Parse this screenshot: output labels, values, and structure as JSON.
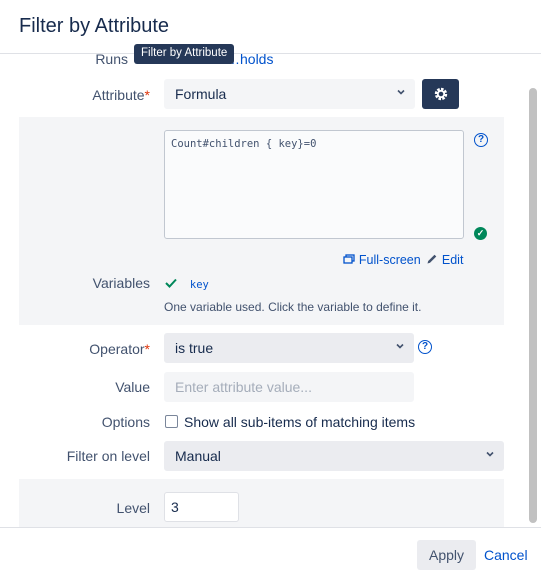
{
  "dialog": {
    "title": "Filter by Attribute"
  },
  "tooltip": "Filter by Attribute",
  "runs": {
    "label": "Runs",
    "value": "…holds"
  },
  "attribute": {
    "label": "Attribute",
    "required_mark": "*",
    "selected": "Formula"
  },
  "formula": {
    "text": "Count#children { key}=0",
    "fullscreen_label": "Full-screen",
    "edit_label": "Edit"
  },
  "variables": {
    "label": "Variables",
    "items": [
      "key"
    ],
    "hint": "One variable used. Click the variable to define it."
  },
  "operator": {
    "label": "Operator",
    "required_mark": "*",
    "selected": "is true"
  },
  "value": {
    "label": "Value",
    "placeholder": "Enter attribute value..."
  },
  "options": {
    "label": "Options",
    "checkbox_label": "Show all sub-items of matching items",
    "checked": false
  },
  "filter_on_level": {
    "label": "Filter on level",
    "selected": "Manual"
  },
  "level": {
    "label": "Level",
    "value": "3"
  },
  "footer": {
    "apply_label": "Apply",
    "cancel_label": "Cancel"
  },
  "colors": {
    "primary": "#0052cc",
    "dark": "#253858",
    "success": "#00875a",
    "required": "#de350b"
  },
  "icons": [
    "gear-icon",
    "help-icon",
    "check-circle-icon",
    "checkmark-icon",
    "fullscreen-icon",
    "pencil-icon",
    "chevron-down-icon"
  ]
}
